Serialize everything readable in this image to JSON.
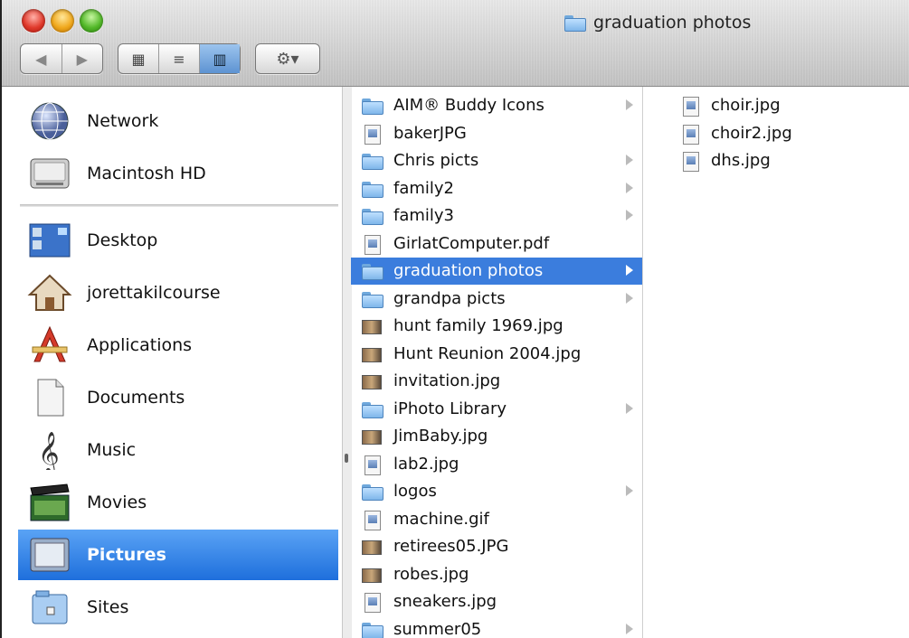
{
  "window": {
    "title": "graduation photos"
  },
  "toolbar": {
    "back_glyph": "◀",
    "forward_glyph": "▶",
    "view_icons_glyph": "▦",
    "view_list_glyph": "≡",
    "view_columns_glyph": "▥",
    "action_glyph": "⚙▾"
  },
  "sidebar": {
    "devices": [
      {
        "label": "Network",
        "icon": "network-globe-icon"
      },
      {
        "label": "Macintosh HD",
        "icon": "hard-drive-icon"
      }
    ],
    "places": [
      {
        "label": "Desktop",
        "icon": "desktop-icon"
      },
      {
        "label": "jorettakilcourse",
        "icon": "home-icon"
      },
      {
        "label": "Applications",
        "icon": "applications-icon"
      },
      {
        "label": "Documents",
        "icon": "documents-icon"
      },
      {
        "label": "Music",
        "icon": "music-icon"
      },
      {
        "label": "Movies",
        "icon": "movies-icon"
      },
      {
        "label": "Pictures",
        "icon": "pictures-icon",
        "selected": true
      },
      {
        "label": "Sites",
        "icon": "sites-icon"
      }
    ]
  },
  "column1": {
    "items": [
      {
        "name": "AIM® Buddy Icons",
        "kind": "folder",
        "has_children": true
      },
      {
        "name": "bakerJPG",
        "kind": "image"
      },
      {
        "name": "Chris picts",
        "kind": "folder",
        "has_children": true
      },
      {
        "name": "family2",
        "kind": "folder",
        "has_children": true
      },
      {
        "name": "family3",
        "kind": "folder",
        "has_children": true
      },
      {
        "name": "GirlatComputer.pdf",
        "kind": "pdf"
      },
      {
        "name": "graduation photos",
        "kind": "folder",
        "has_children": true,
        "selected": true
      },
      {
        "name": "grandpa picts",
        "kind": "folder",
        "has_children": true
      },
      {
        "name": "hunt family 1969.jpg",
        "kind": "thumb"
      },
      {
        "name": "Hunt Reunion 2004.jpg",
        "kind": "thumb"
      },
      {
        "name": "invitation.jpg",
        "kind": "thumb"
      },
      {
        "name": "iPhoto Library",
        "kind": "folder",
        "has_children": true
      },
      {
        "name": "JimBaby.jpg",
        "kind": "thumb"
      },
      {
        "name": "lab2.jpg",
        "kind": "image"
      },
      {
        "name": "logos",
        "kind": "folder",
        "has_children": true
      },
      {
        "name": "machine.gif",
        "kind": "image"
      },
      {
        "name": "retirees05.JPG",
        "kind": "thumb"
      },
      {
        "name": "robes.jpg",
        "kind": "thumb"
      },
      {
        "name": "sneakers.jpg",
        "kind": "image"
      },
      {
        "name": "summer05",
        "kind": "folder",
        "has_children": true
      }
    ]
  },
  "column2": {
    "items": [
      {
        "name": "choir.jpg",
        "kind": "image"
      },
      {
        "name": "choir2.jpg",
        "kind": "image"
      },
      {
        "name": "dhs.jpg",
        "kind": "image"
      }
    ]
  },
  "colors": {
    "selection_blue": "#3b7ddd",
    "sidebar_selection": "#1e6fdc",
    "folder_blue": "#7fb6ea"
  }
}
